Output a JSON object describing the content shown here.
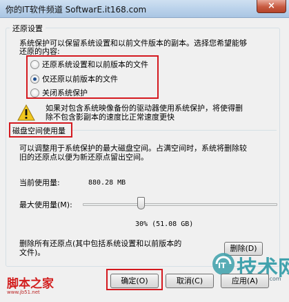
{
  "window": {
    "title": "你的IT软件频道 SoftwarE.it168.com",
    "close_glyph": "×"
  },
  "restore": {
    "group_title": "还原设置",
    "description_line1": "系统保护可以保留系统设置和以前文件版本的副本。选择您希望能够",
    "description_line2": "还原的内容:",
    "options": [
      {
        "label": "还原系统设置和以前版本的文件",
        "selected": false
      },
      {
        "label": "仅还原以前版本的文件",
        "selected": true
      },
      {
        "label": "关闭系统保护",
        "selected": false
      }
    ],
    "warning_line1": "如果对包含系统映像备份的驱动器使用系统保护，将使得删",
    "warning_line2": "除不包含影副本的速度比正常速度更快"
  },
  "disk": {
    "section_title": "磁盘空间使用量",
    "description_line1": "可以调整用于系统保护的最大磁盘空间。占满空间时，系统将删除较",
    "description_line2": "旧的还原点以便为新还原点留出空间。",
    "current_usage_label": "当前使用量:",
    "current_usage_value": "880.28 MB",
    "max_usage_label": "最大使用量(M):",
    "max_usage_fraction": 0.3,
    "max_usage_value": "30% (51.08 GB)",
    "delete_text_line1": "删除所有还原点(其中包括系统设置和以前版本的",
    "delete_text_line2": "文件)。",
    "delete_button": "删除(D)"
  },
  "footer": {
    "ok_button": "确定(O)",
    "cancel_button": "取消(C)",
    "apply_button": "应用(A)"
  },
  "watermarks": {
    "left_brand": "脚本之家",
    "left_url": "www.jb51.net",
    "right_brand": "技术网",
    "right_url": "www.it168.com"
  },
  "colors": {
    "highlight_box": "#d4191f",
    "radio_dot": "#1f4f8f"
  }
}
